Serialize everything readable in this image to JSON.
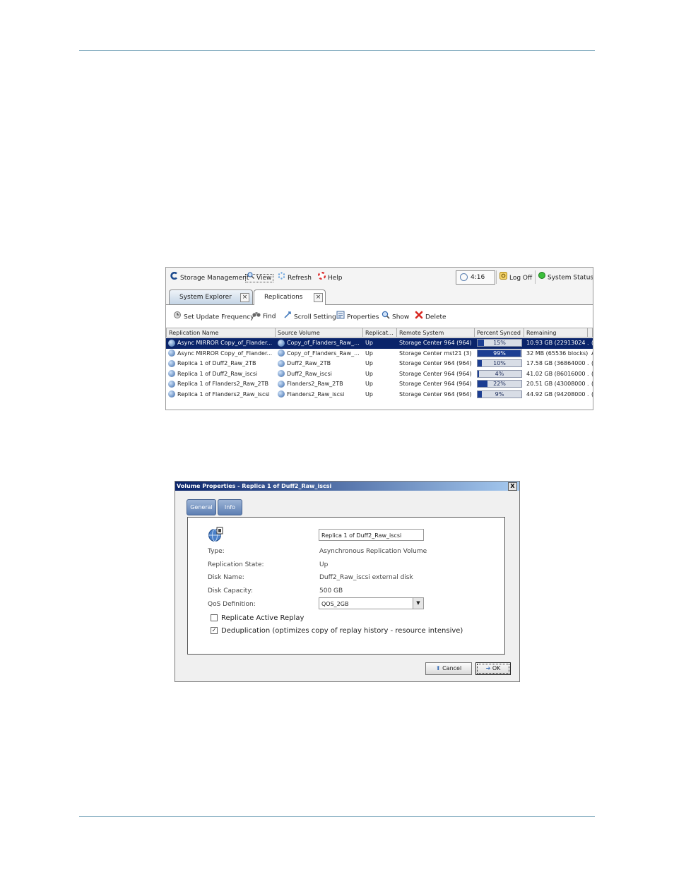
{
  "app": {
    "menubar": {
      "storage_management": "Storage Management",
      "view": "View",
      "refresh": "Refresh",
      "help": "Help",
      "time": "4:16 PM",
      "log_off": "Log Off",
      "system_status": "System Status"
    },
    "tabs": [
      {
        "label": "System Explorer"
      },
      {
        "label": "Replications"
      }
    ],
    "toolbar": {
      "set_update_frequency": "Set Update Frequency",
      "find": "Find",
      "scroll_setting": "Scroll Setting",
      "properties": "Properties",
      "show": "Show",
      "delete": "Delete"
    },
    "table": {
      "columns": [
        "Replication Name",
        "Source Volume",
        "Replicat...",
        "Remote System",
        "Percent Synced",
        "Remaining"
      ],
      "rows": [
        {
          "name": "Async MIRROR Copy_of_Flander...",
          "source": "Copy_of_Flanders_Raw_...",
          "state": "Up",
          "remote": "Storage Center 964 (964)",
          "percent": 15,
          "percent_label": "15%",
          "remaining": "10.93 GB (22913024 ...",
          "extra": "(",
          "selected": true
        },
        {
          "name": "Async MIRROR Copy_of_Flander...",
          "source": "Copy_of_Flanders_Raw_...",
          "state": "Up",
          "remote": "Storage Center mst21 (3)",
          "percent": 99,
          "percent_label": "99%",
          "remaining": "32 MB (65536 blocks)",
          "extra": "A",
          "selected": false
        },
        {
          "name": "Replica 1 of Duff2_Raw_2TB",
          "source": "Duff2_Raw_2TB",
          "state": "Up",
          "remote": "Storage Center 964 (964)",
          "percent": 10,
          "percent_label": "10%",
          "remaining": "17.58 GB (36864000 ...",
          "extra": "(",
          "selected": false
        },
        {
          "name": "Replica 1 of Duff2_Raw_iscsi",
          "source": "Duff2_Raw_iscsi",
          "state": "Up",
          "remote": "Storage Center 964 (964)",
          "percent": 4,
          "percent_label": "4%",
          "remaining": "41.02 GB (86016000 ...",
          "extra": "(",
          "selected": false
        },
        {
          "name": "Replica 1 of Flanders2_Raw_2TB",
          "source": "Flanders2_Raw_2TB",
          "state": "Up",
          "remote": "Storage Center 964 (964)",
          "percent": 22,
          "percent_label": "22%",
          "remaining": "20.51 GB (43008000 ...",
          "extra": "(",
          "selected": false
        },
        {
          "name": "Replica 1 of Flanders2_Raw_iscsi",
          "source": "Flanders2_Raw_iscsi",
          "state": "Up",
          "remote": "Storage Center 964 (964)",
          "percent": 9,
          "percent_label": "9%",
          "remaining": "44.92 GB (94208000 ...",
          "extra": "(",
          "selected": false
        }
      ]
    }
  },
  "dialog": {
    "title": "Volume Properties - Replica 1 of Duff2_Raw_iscsi",
    "close": "X",
    "tabs": [
      "General",
      "Info"
    ],
    "name_value": "Replica 1 of Duff2_Raw_iscsi",
    "fields": [
      {
        "label": "Type:",
        "value": "Asynchronous Replication Volume"
      },
      {
        "label": "Replication State:",
        "value": "Up"
      },
      {
        "label": "Disk Name:",
        "value": "Duff2_Raw_iscsi external disk"
      },
      {
        "label": "Disk Capacity:",
        "value": "500 GB"
      }
    ],
    "qos_label": "QoS Definition:",
    "qos_value": "QOS_2GB",
    "replicate_active_replay": {
      "label": "Replicate Active Replay",
      "checked": false
    },
    "deduplication": {
      "label": "Deduplication (optimizes copy of replay history - resource intensive)",
      "checked": true
    },
    "cancel": "Cancel",
    "ok": "OK"
  },
  "colors": {
    "selection": "#0a246a",
    "progress": "#1c3e92",
    "rule": "#8fb4c6"
  }
}
